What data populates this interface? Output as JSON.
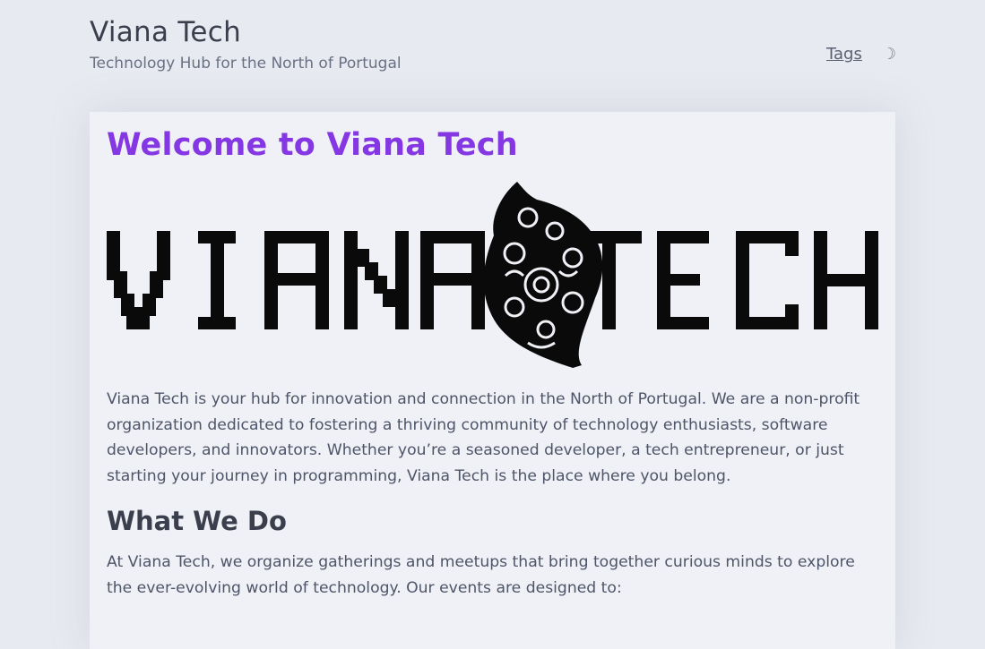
{
  "header": {
    "title": "Viana Tech",
    "subtitle": "Technology Hub for the North of Portugal",
    "nav": {
      "tags_label": "Tags",
      "theme_toggle_glyph": "☽",
      "theme_toggle_icon": "moon-icon"
    }
  },
  "main": {
    "title": "Welcome to Viana Tech",
    "logo": {
      "text_left": "VIANA",
      "text_right": "TECH",
      "icon": "ornate-heart-map-icon",
      "color": "#0a0a0a"
    },
    "intro": "Viana Tech is your hub for innovation and connection in the North of Portugal. We are a non-profit organization dedicated to fostering a thriving community of technology enthusiasts, software developers, and innovators. Whether you’re a seasoned developer, a tech entrepreneur, or just starting your journey in programming, Viana Tech is the place where you belong.",
    "what_we_do": {
      "heading": "What We Do",
      "text": "At Viana Tech, we organize gatherings and meetups that bring together curious minds to explore the ever-evolving world of technology. Our events are designed to:"
    }
  },
  "colors": {
    "accent": "#8437e3",
    "background": "#e8eaf1",
    "card": "#eff1f6",
    "text": "#4e5568"
  }
}
